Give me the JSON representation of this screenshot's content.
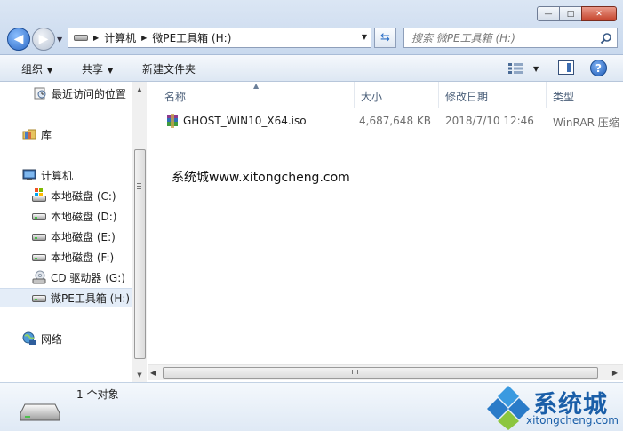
{
  "window_controls": {
    "minimize": "—",
    "maximize": "□",
    "close": "✕"
  },
  "address": {
    "crumbs": [
      "计算机",
      "微PE工具箱 (H:)"
    ]
  },
  "search": {
    "placeholder": "搜索 微PE工具箱 (H:)"
  },
  "commands": {
    "organize": "组织",
    "share": "共享",
    "new_folder": "新建文件夹",
    "view_icon": "view-icon",
    "help": "?"
  },
  "nav": {
    "items": [
      {
        "label": "最近访问的位置",
        "icon": "recent-places-icon"
      },
      {
        "label": "库",
        "icon": "library-icon"
      },
      {
        "label": "计算机",
        "icon": "computer-icon"
      },
      {
        "label": "本地磁盘 (C:)",
        "icon": "system-drive-icon"
      },
      {
        "label": "本地磁盘 (D:)",
        "icon": "drive-icon"
      },
      {
        "label": "本地磁盘 (E:)",
        "icon": "drive-icon"
      },
      {
        "label": "本地磁盘 (F:)",
        "icon": "drive-icon"
      },
      {
        "label": "CD 驱动器 (G:)",
        "icon": "cd-drive-icon"
      },
      {
        "label": "微PE工具箱 (H:)",
        "icon": "drive-icon",
        "selected": true
      },
      {
        "label": "网络",
        "icon": "network-icon"
      }
    ]
  },
  "columns": {
    "name": "名称",
    "size": "大小",
    "modified": "修改日期",
    "type": "类型"
  },
  "files": [
    {
      "name": "GHOST_WIN10_X64.iso",
      "size": "4,687,648 KB",
      "modified": "2018/7/10 12:46",
      "type": "WinRAR 压缩",
      "icon": "winrar-archive-icon"
    }
  ],
  "content_note": "系统城www.xitongcheng.com",
  "details": {
    "count": "1 个对象"
  },
  "logo": {
    "name": "系统城",
    "url": "xitongcheng.com"
  },
  "colors": {
    "accent": "#1a5ea8",
    "selection": "#e4edf8",
    "header_text": "#4c607a"
  }
}
